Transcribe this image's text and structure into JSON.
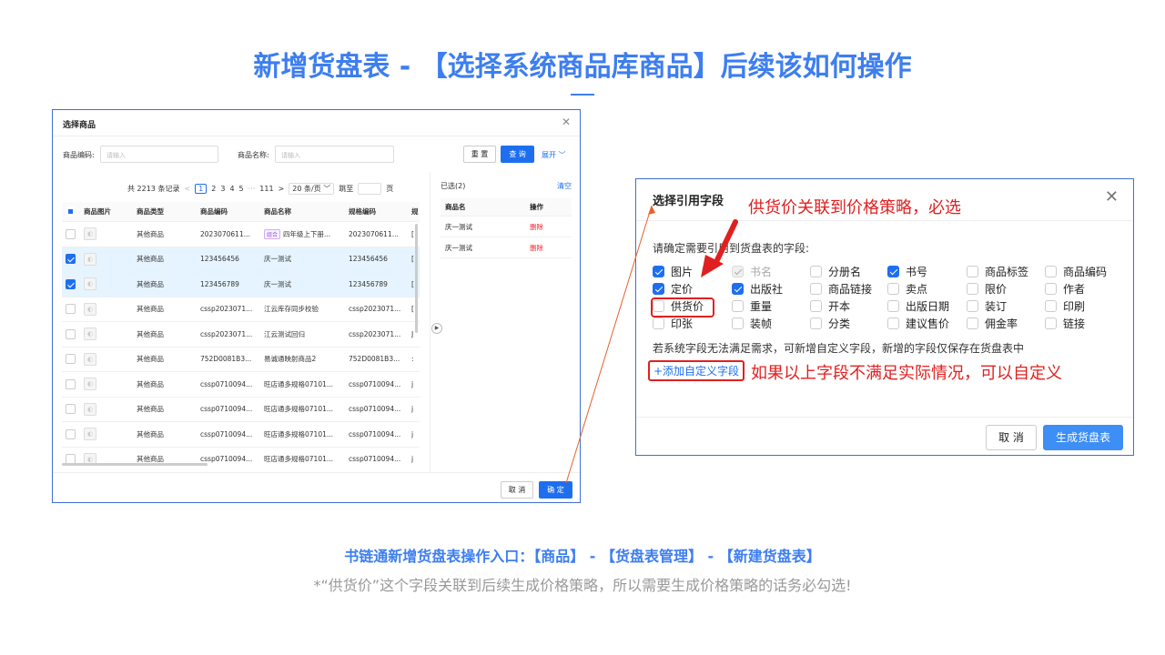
{
  "title": "新增货盘表 - 【选择系统商品库商品】后续该如何操作",
  "left_modal": {
    "title": "选择商品",
    "code_label": "商品编码:",
    "code_placeholder": "请输入",
    "name_label": "商品名称:",
    "name_placeholder": "请输入",
    "reset": "重 置",
    "query": "查 询",
    "expand": "展开 ﹀",
    "pager": {
      "total": "共 2213 条记录",
      "prev": "<",
      "pages": [
        "1",
        "2",
        "3",
        "4",
        "5",
        "···",
        "111"
      ],
      "next": ">",
      "size": "20 条/页 ﹀",
      "jump": "跳至",
      "page_unit": "页"
    },
    "columns": [
      "商品图片",
      "商品类型",
      "商品编码",
      "商品名称",
      "规格编码",
      "规"
    ],
    "rows": [
      {
        "type": "其他商品",
        "code": "2023070611...",
        "tag": "组合",
        "name": "四年级上下册...",
        "spec": "2023070611...",
        "extra": "[",
        "checked": false
      },
      {
        "type": "其他商品",
        "code": "123456456",
        "tag": "",
        "name": "庆一测试",
        "spec": "123456456",
        "extra": "[",
        "checked": true
      },
      {
        "type": "其他商品",
        "code": "123456789",
        "tag": "",
        "name": "庆一测试",
        "spec": "123456789",
        "extra": "[",
        "checked": true
      },
      {
        "type": "其他商品",
        "code": "cssp2023071...",
        "tag": "",
        "name": "江云库存同步校验",
        "spec": "cssp2023071...",
        "extra": "[",
        "checked": false
      },
      {
        "type": "其他商品",
        "code": "cssp2023071...",
        "tag": "",
        "name": "江云测试回归",
        "spec": "cssp2023071...",
        "extra": "J",
        "checked": false
      },
      {
        "type": "其他商品",
        "code": "752D0081B3...",
        "tag": "",
        "name": "易诚通映射商品2",
        "spec": "752D0081B3...",
        "extra": ":",
        "checked": false
      },
      {
        "type": "其他商品",
        "code": "cssp0710094...",
        "tag": "",
        "name": "旺店通多规格07101...",
        "spec": "cssp0710094...",
        "extra": "j",
        "checked": false
      },
      {
        "type": "其他商品",
        "code": "cssp0710094...",
        "tag": "",
        "name": "旺店通多规格07101...",
        "spec": "cssp0710094...",
        "extra": "j",
        "checked": false
      },
      {
        "type": "其他商品",
        "code": "cssp0710094...",
        "tag": "",
        "name": "旺店通多规格07101...",
        "spec": "cssp0710094...",
        "extra": "j",
        "checked": false
      },
      {
        "type": "其他商品",
        "code": "cssp0710094...",
        "tag": "",
        "name": "旺店通多规格07101...",
        "spec": "cssp0710094...",
        "extra": "j",
        "checked": false
      }
    ],
    "selected_title": "已选(2)",
    "clear": "清空",
    "selected_columns": [
      "商品名",
      "操作"
    ],
    "selected_rows": [
      {
        "name": "庆一测试",
        "action": "删除"
      },
      {
        "name": "庆一测试",
        "action": "删除"
      }
    ],
    "cancel": "取 消",
    "ok": "确 定"
  },
  "right_modal": {
    "title": "选择引用字段",
    "instruction": "请确定需要引用到货盘表的字段:",
    "fields": [
      [
        {
          "label": "图片",
          "state": "on"
        },
        {
          "label": "书名",
          "state": "disabled"
        },
        {
          "label": "分册名",
          "state": "off"
        },
        {
          "label": "书号",
          "state": "on"
        },
        {
          "label": "商品标签",
          "state": "off"
        },
        {
          "label": "商品编码",
          "state": "off"
        }
      ],
      [
        {
          "label": "定价",
          "state": "on"
        },
        {
          "label": "出版社",
          "state": "on"
        },
        {
          "label": "商品链接",
          "state": "off"
        },
        {
          "label": "卖点",
          "state": "off"
        },
        {
          "label": "限价",
          "state": "off"
        },
        {
          "label": "作者",
          "state": "off"
        }
      ],
      [
        {
          "label": "供货价",
          "state": "off"
        },
        {
          "label": "重量",
          "state": "off"
        },
        {
          "label": "开本",
          "state": "off"
        },
        {
          "label": "出版日期",
          "state": "off"
        },
        {
          "label": "装订",
          "state": "off"
        },
        {
          "label": "印刷",
          "state": "off"
        }
      ],
      [
        {
          "label": "印张",
          "state": "off"
        },
        {
          "label": "装帧",
          "state": "off"
        },
        {
          "label": "分类",
          "state": "off"
        },
        {
          "label": "建议售价",
          "state": "off"
        },
        {
          "label": "佣金率",
          "state": "off"
        },
        {
          "label": "链接",
          "state": "off"
        }
      ]
    ],
    "custom_note": "若系统字段无法满足需求，可新增自定义字段，新增的字段仅保存在货盘表中",
    "add_custom": "+添加自定义字段",
    "cancel": "取 消",
    "generate": "生成货盘表"
  },
  "annotations": {
    "supply_price": "供货价关联到价格策略，必选",
    "custom_field": "如果以上字段不满足实际情况，可以自定义"
  },
  "footer": {
    "entry": "书链通新增货盘表操作入口：【商品】 - 【货盘表管理】 - 【新建货盘表】",
    "note": "*“供货价”这个字段关联到后续生成价格策略，所以需要生成价格策略的话务必勾选!"
  },
  "colors": {
    "accent": "#3d7ef0",
    "primary_button": "#1e6ff0",
    "annotation_red": "#e02020"
  }
}
